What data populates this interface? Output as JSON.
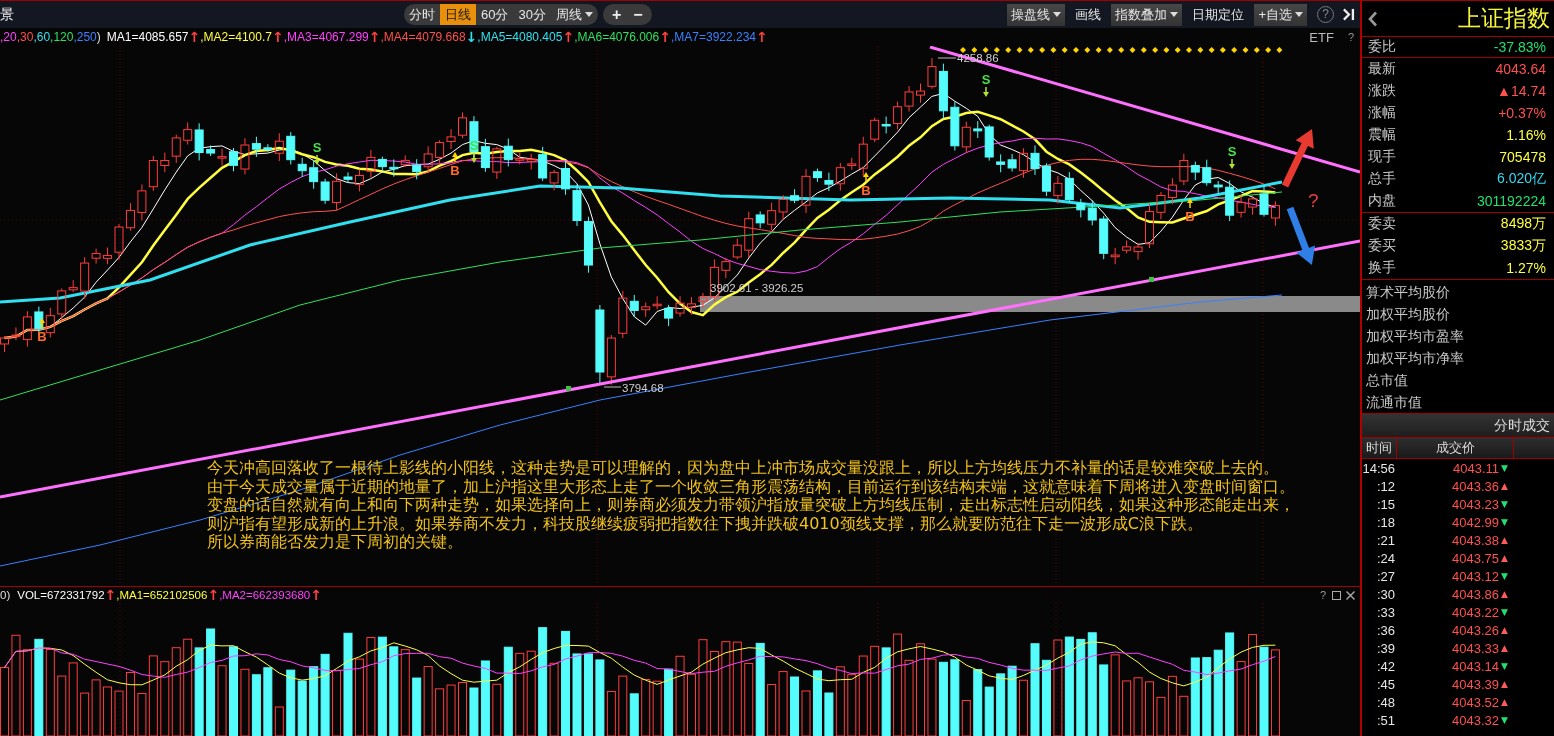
{
  "toolbar": {
    "left_label": "景",
    "periods": [
      {
        "label": "分时",
        "kind": "plain",
        "selected": false
      },
      {
        "label": "日线",
        "kind": "plain",
        "selected": true
      },
      {
        "label": "60分",
        "kind": "plain",
        "selected": false
      },
      {
        "label": "30分",
        "kind": "plain",
        "selected": false
      },
      {
        "label": "周线",
        "kind": "dropdown",
        "selected": false
      }
    ],
    "zoom_buttons": [
      "+",
      "−"
    ],
    "tools": [
      {
        "label": "操盘线",
        "kind": "dropdown"
      },
      {
        "label": "画线",
        "kind": "plain"
      },
      {
        "label": "指数叠加",
        "kind": "dropdown"
      },
      {
        "label": "日期定位",
        "kind": "plain"
      },
      {
        "label": "+自选",
        "kind": "dropdown"
      }
    ],
    "help_label": "?"
  },
  "ma_legend": {
    "periods": [
      {
        "text": ",20",
        "color": "#ff40ff"
      },
      {
        "text": ",30",
        "color": "#ff5050"
      },
      {
        "text": ",60",
        "color": "#30e0f0"
      },
      {
        "text": ",120",
        "color": "#30e060"
      },
      {
        "text": ",250",
        "color": "#3a80ff"
      }
    ],
    "periods_end": ")",
    "items": [
      {
        "kind": "value",
        "text": "MA1=4085.657",
        "color": "#ffffff"
      },
      {
        "kind": "arrow",
        "text": "↑",
        "color": "#ff4040"
      },
      {
        "kind": "value",
        "text": ",MA2=4100.7",
        "color": "#ffff40"
      },
      {
        "kind": "arrow",
        "text": "↑",
        "color": "#ff4040"
      },
      {
        "kind": "value",
        "text": ",MA3=4067.299",
        "color": "#ff40ff"
      },
      {
        "kind": "arrow",
        "text": "↑",
        "color": "#ff4040"
      },
      {
        "kind": "value",
        "text": ",MA4=4079.668",
        "color": "#ff5050"
      },
      {
        "kind": "arrow",
        "text": "↓",
        "color": "#30e0f0"
      },
      {
        "kind": "value",
        "text": ",MA5=4080.405",
        "color": "#30e0f0"
      },
      {
        "kind": "arrow",
        "text": "↑",
        "color": "#ff4040"
      },
      {
        "kind": "value",
        "text": ",MA6=4076.006",
        "color": "#30e060"
      },
      {
        "kind": "arrow",
        "text": "↑",
        "color": "#ff4040"
      },
      {
        "kind": "value",
        "text": ",MA7=3922.234",
        "color": "#3a80ff"
      },
      {
        "kind": "arrow",
        "text": "↑",
        "color": "#ff4040"
      }
    ],
    "etf_label": "ETF",
    "help_label": "?"
  },
  "chart": {
    "high_label": "4258.86",
    "range_label": "3902.61 - 3926.25",
    "low_label": "3794.68",
    "question_label": "?",
    "signals": [
      {
        "kind": "buy",
        "label": "B"
      },
      {
        "kind": "sell",
        "label": "S"
      },
      {
        "kind": "buy",
        "label": "B"
      },
      {
        "kind": "sell",
        "label": "S"
      },
      {
        "kind": "buy",
        "label": "B"
      },
      {
        "kind": "sell",
        "label": "S"
      },
      {
        "kind": "buy",
        "label": "B"
      },
      {
        "kind": "sell",
        "label": "S"
      }
    ]
  },
  "annotation": {
    "lines": [
      "今天冲高回落收了一根待上影线的小阳线，这种走势是可以理解的，因为盘中上冲市场成交量没跟上，所以上方均线压力不补量的话是较难突破上去的。",
      "由于今天成交量属于近期的地量了，加上沪指这里大形态上走了一个收敛三角形震荡结构，目前运行到该结构末端，这就意味着下周将进入变盘时间窗口。",
      "变盘的话自然就有向上和向下两种走势，如果选择向上，则券商必须发力带领沪指放量突破上方均线压制，走出标志性启动阳线，如果这种形态能走出来，",
      "则沪指有望形成新的上升浪。如果券商不发力，科技股继续疲弱把指数往下拽并跌破4010颈线支撑，那么就要防范往下走一波形成C浪下跌。",
      "所以券商能否发力是下周初的关键。"
    ]
  },
  "volume": {
    "prefix": "0)",
    "items": [
      {
        "kind": "value",
        "text": "VOL=672331792",
        "color": "#ffffff"
      },
      {
        "kind": "arrow",
        "text": "↑",
        "color": "#ff4040"
      },
      {
        "kind": "value",
        "text": ",MA1=652102506",
        "color": "#ffff40"
      },
      {
        "kind": "arrow",
        "text": "↑",
        "color": "#ff4040"
      },
      {
        "kind": "value",
        "text": ",MA2=662393680",
        "color": "#ff40ff"
      },
      {
        "kind": "arrow",
        "text": "↑",
        "color": "#ff4040"
      }
    ],
    "help_label": "?"
  },
  "quote": {
    "title": "上证指数",
    "ratio": {
      "label": "委比",
      "value": "-37.83%",
      "color": "#20e070"
    },
    "stats": [
      {
        "label": "最新",
        "value": "4043.64",
        "color": "#ff5050"
      },
      {
        "label": "涨跌",
        "value": "▲14.74",
        "color": "#ff5050"
      },
      {
        "label": "涨幅",
        "value": "+0.37%",
        "color": "#ff5050"
      },
      {
        "label": "震幅",
        "value": "1.16%",
        "color": "#ffff40"
      },
      {
        "label": "现手",
        "value": "705478",
        "color": "#ffff40"
      },
      {
        "label": "总手",
        "value": "6.020亿",
        "color": "#30d8f0"
      },
      {
        "label": "内盘",
        "value": "301192224",
        "color": "#20e070"
      }
    ],
    "orders": [
      {
        "label": "委卖",
        "value": "8498万"
      },
      {
        "label": "委买",
        "value": "3833万"
      },
      {
        "label": "换手",
        "value": "1.27%"
      }
    ],
    "averages": [
      "算术平均股价",
      "加权平均股价",
      "加权平均市盈率",
      "加权平均市净率",
      "总市值",
      "流通市值"
    ]
  },
  "trades": {
    "title": "分时成交",
    "columns": [
      "时间",
      "成交价"
    ],
    "rows": [
      {
        "time": "14:56",
        "price": "4043.11",
        "arrow": "▼",
        "color": "#20e070"
      },
      {
        "time": ":12",
        "price": "4043.36",
        "arrow": "▲",
        "color": "#ff5a5a"
      },
      {
        "time": ":15",
        "price": "4043.23",
        "arrow": "▼",
        "color": "#20e070"
      },
      {
        "time": ":18",
        "price": "4042.99",
        "arrow": "▼",
        "color": "#20e070"
      },
      {
        "time": ":21",
        "price": "4043.38",
        "arrow": "▲",
        "color": "#ff5a5a"
      },
      {
        "time": ":24",
        "price": "4043.75",
        "arrow": "▲",
        "color": "#ff5a5a"
      },
      {
        "time": ":27",
        "price": "4043.12",
        "arrow": "▼",
        "color": "#20e070"
      },
      {
        "time": ":30",
        "price": "4043.86",
        "arrow": "▲",
        "color": "#ff5a5a"
      },
      {
        "time": ":33",
        "price": "4043.22",
        "arrow": "▼",
        "color": "#20e070"
      },
      {
        "time": ":36",
        "price": "4043.26",
        "arrow": "▲",
        "color": "#ff5a5a"
      },
      {
        "time": ":39",
        "price": "4043.33",
        "arrow": "▲",
        "color": "#ff5a5a"
      },
      {
        "time": ":42",
        "price": "4043.14",
        "arrow": "▼",
        "color": "#20e070"
      },
      {
        "time": ":45",
        "price": "4043.39",
        "arrow": "▲",
        "color": "#ff5a5a"
      },
      {
        "time": ":48",
        "price": "4043.52",
        "arrow": "▲",
        "color": "#ff5a5a"
      },
      {
        "time": ":51",
        "price": "4043.32",
        "arrow": "▼",
        "color": "#20e070"
      }
    ]
  }
}
